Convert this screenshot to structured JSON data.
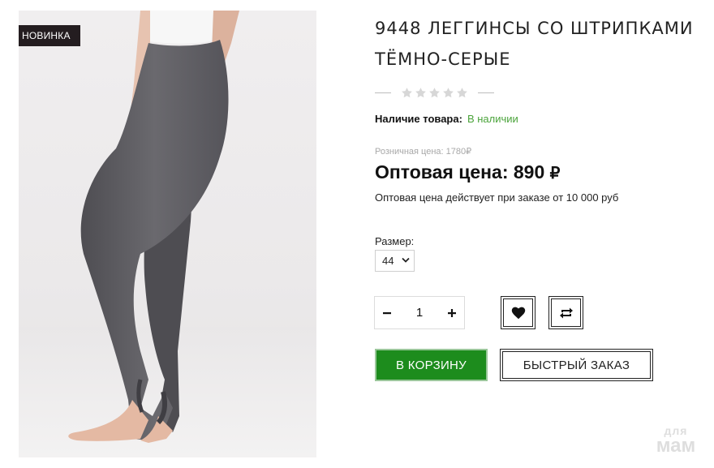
{
  "badge": "НОВИНКА",
  "product": {
    "title": "9448 ЛЕГГИНСЫ СО ШТРИПКАМИ ТЁМНО-СЕРЫЕ",
    "rating": 0,
    "stock_label": "Наличие товара:",
    "stock_value": "В наличии",
    "retail_price": "Розничная цена: 1780₽",
    "wholesale_label": "Оптовая цена: 890",
    "currency": "₽",
    "note": "Оптовая цена действует при заказе от 10 000 руб"
  },
  "size": {
    "label": "Размер:",
    "selected": "44"
  },
  "quantity": {
    "value": "1",
    "minus": "−",
    "plus": "+"
  },
  "actions": {
    "cart": "В КОРЗИНУ",
    "quick_order": "БЫСТРЫЙ ЗАКАЗ"
  },
  "icons": {
    "wishlist": "heart-icon",
    "compare": "compare-icon"
  },
  "watermark": {
    "top": "для",
    "bottom": "мам"
  },
  "colors": {
    "in_stock": "#4aa33a",
    "cart_button": "#1d8c1d",
    "badge_bg": "#241d20"
  }
}
